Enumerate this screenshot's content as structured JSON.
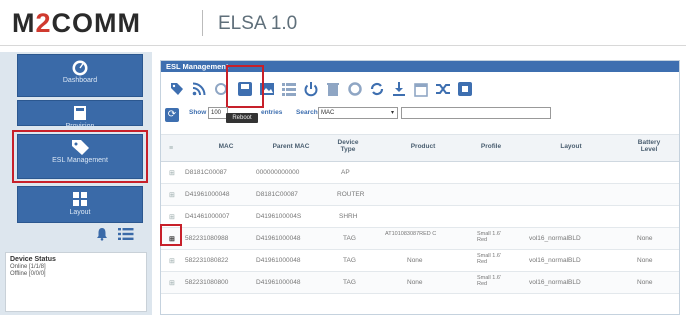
{
  "header": {
    "logo_m": "M",
    "logo_2": "2",
    "logo_rest": "COMM",
    "app_title": "ELSA 1.0"
  },
  "sidebar": {
    "items": [
      {
        "label": "Dashboard",
        "icon": "dashboard-icon"
      },
      {
        "label": "Provision",
        "icon": "provision-icon"
      },
      {
        "label": "ESL Management",
        "icon": "tag-icon"
      },
      {
        "label": "Layout",
        "icon": "layout-icon"
      }
    ],
    "device_status": {
      "title": "Device Status",
      "online": "Online [1/1/8]",
      "offline": "Offline [0/0/0]"
    }
  },
  "panel": {
    "title": "ESL Management",
    "toolbar_icons": [
      "tag-icon",
      "rss-icon",
      "reboot-icon",
      "save-icon",
      "image-icon",
      "list-icon",
      "power-icon",
      "trash-icon",
      "settings-icon",
      "refresh-icon",
      "download-icon",
      "calendar-icon",
      "shuffle-icon",
      "window-icon"
    ],
    "filters": {
      "show_label": "Show",
      "show_value": "100",
      "tooltip": "Reboot",
      "entries_label": "entries",
      "search_label": "Search",
      "search_select": "MAC"
    },
    "columns": [
      "MAC",
      "Parent MAC",
      "Device Type",
      "Product",
      "Profile",
      "Layout",
      "Battery Level"
    ],
    "rows": [
      {
        "mac": "D8181C00087",
        "parent": "000000000000",
        "type": "AP",
        "product": "",
        "profile": "",
        "layout": "",
        "battery": ""
      },
      {
        "mac": "D41961000048",
        "parent": "D8181C00087",
        "type": "ROUTER",
        "product": "",
        "profile": "",
        "layout": "",
        "battery": ""
      },
      {
        "mac": "D41461000007",
        "parent": "D4196100004S",
        "type": "SHRH",
        "product": "",
        "profile": "",
        "layout": "",
        "battery": ""
      },
      {
        "mac": "582231080988",
        "parent": "D41961000048",
        "type": "TAG",
        "product": "AT101083087RED C",
        "profile": "Small 1.6' Red",
        "layout": "vol16_normalBLD",
        "battery": "None"
      },
      {
        "mac": "582231080822",
        "parent": "D41961000048",
        "type": "TAG",
        "product": "None",
        "profile": "Small 1.6' Red",
        "layout": "vol16_normalBLD",
        "battery": "None"
      },
      {
        "mac": "582231080800",
        "parent": "D41961000048",
        "type": "TAG",
        "product": "None",
        "profile": "Small 1.6' Red",
        "layout": "vol16_normalBLD",
        "battery": "None"
      }
    ]
  },
  "colors": {
    "accent": "#3e6fb0",
    "highlight": "#c7202a",
    "logo_red": "#d03a2f"
  }
}
